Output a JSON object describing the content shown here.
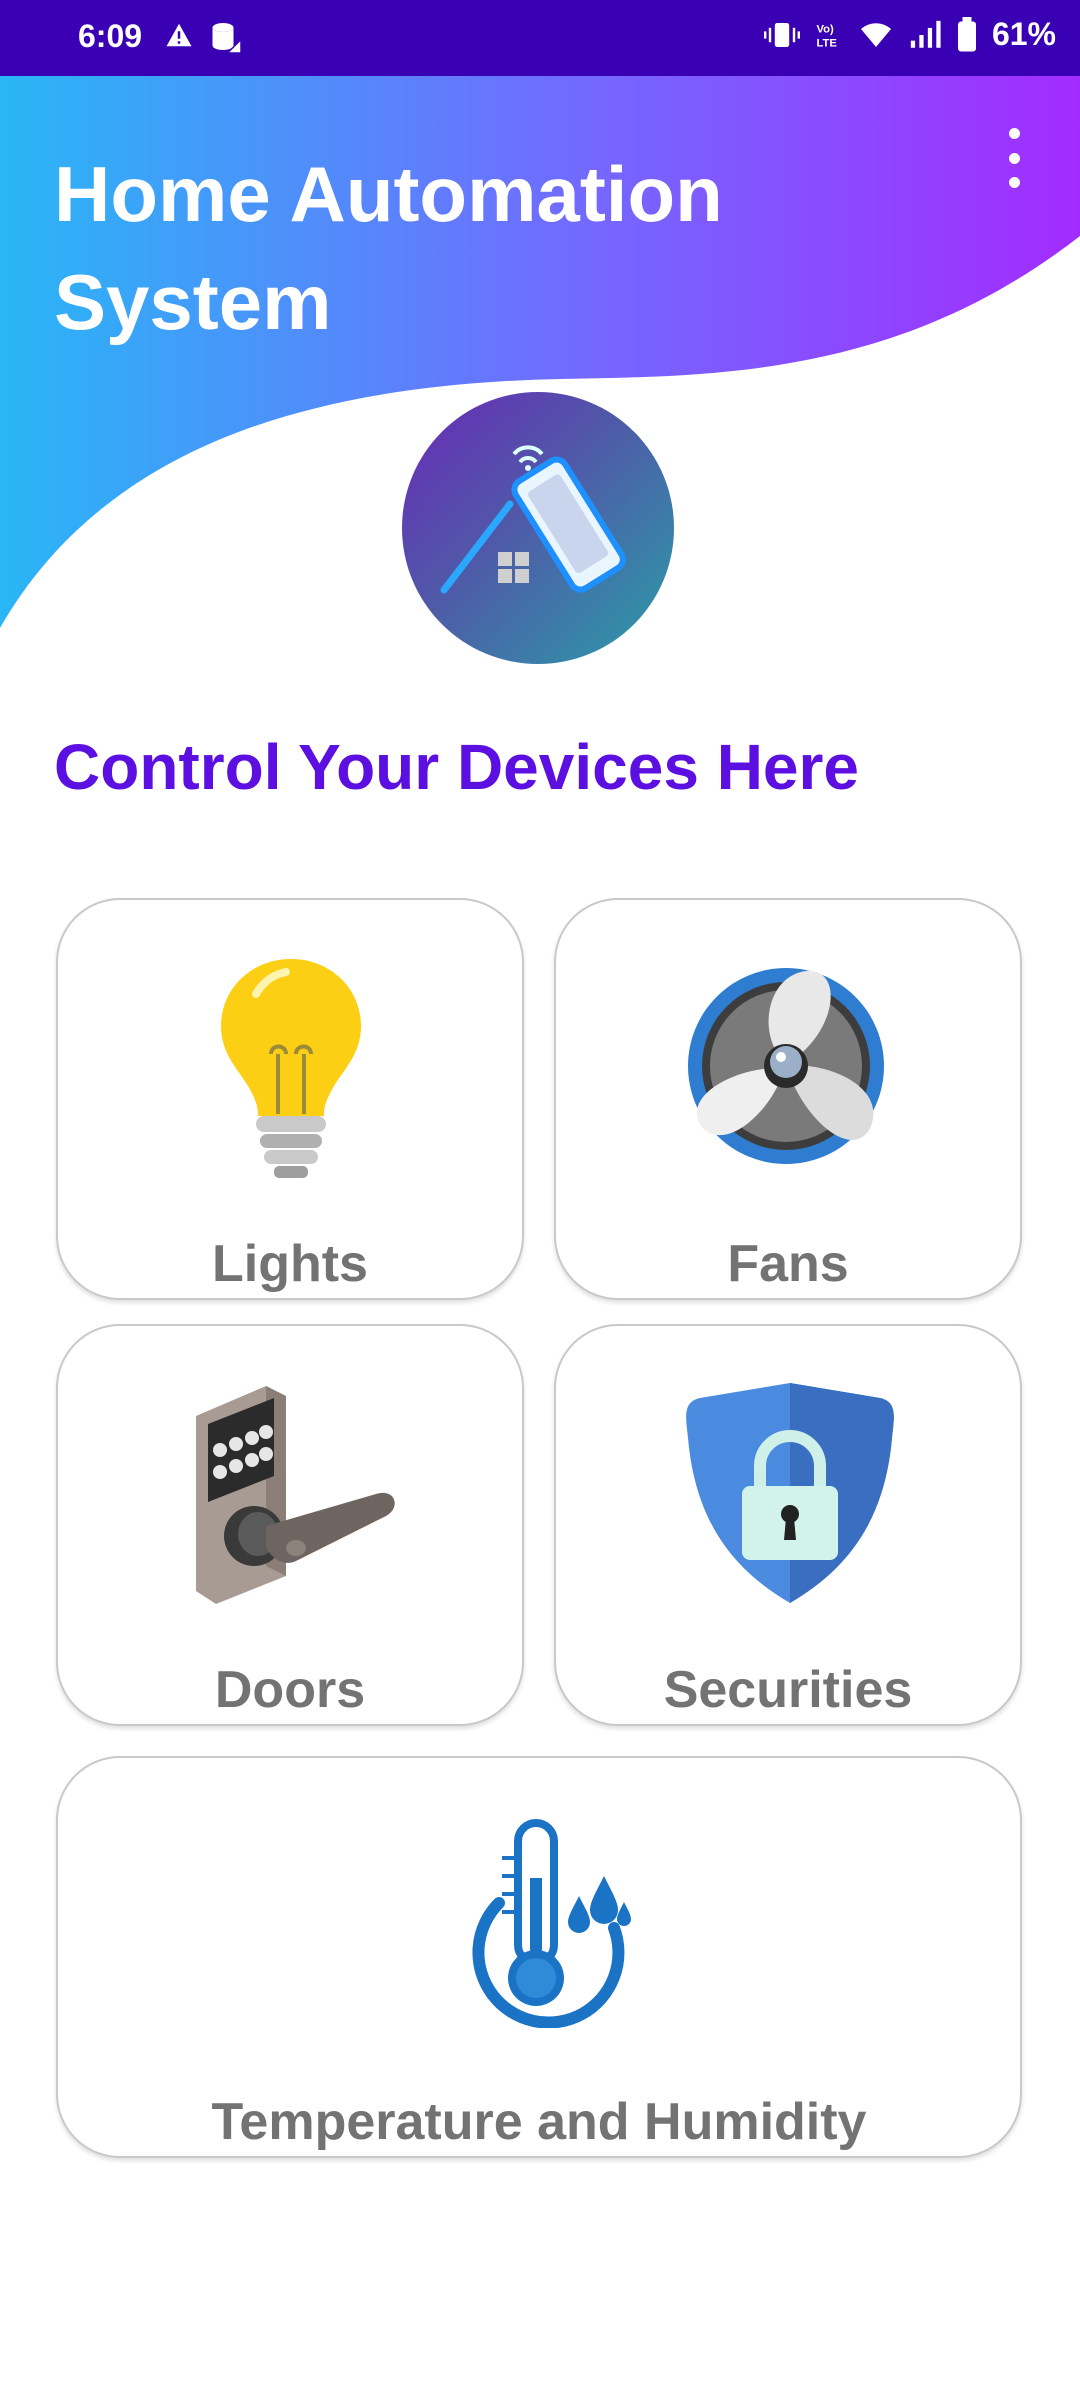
{
  "status_bar": {
    "time": "6:09",
    "battery": "61%",
    "left_icons": [
      "alert-icon",
      "data-saver-icon"
    ],
    "right_icons": [
      "vibrate-icon",
      "volte-icon",
      "wifi-icon",
      "signal-icon",
      "battery-icon"
    ]
  },
  "header": {
    "title": "Home Automation System",
    "menu_icon": "more-vert-icon",
    "gradient": [
      "#29b6f6",
      "#7c5cff",
      "#a030ff"
    ]
  },
  "logo": {
    "icon": "smart-home-phone-icon"
  },
  "section": {
    "title": "Control Your Devices Here",
    "title_color": "#5b0fe0"
  },
  "cards": [
    {
      "label": "Lights",
      "icon": "light-bulb-icon"
    },
    {
      "label": "Fans",
      "icon": "fan-icon"
    },
    {
      "label": "Doors",
      "icon": "door-lock-icon"
    },
    {
      "label": "Securities",
      "icon": "security-shield-icon"
    },
    {
      "label": "Temperature and Humidity",
      "icon": "thermometer-humidity-icon"
    }
  ]
}
